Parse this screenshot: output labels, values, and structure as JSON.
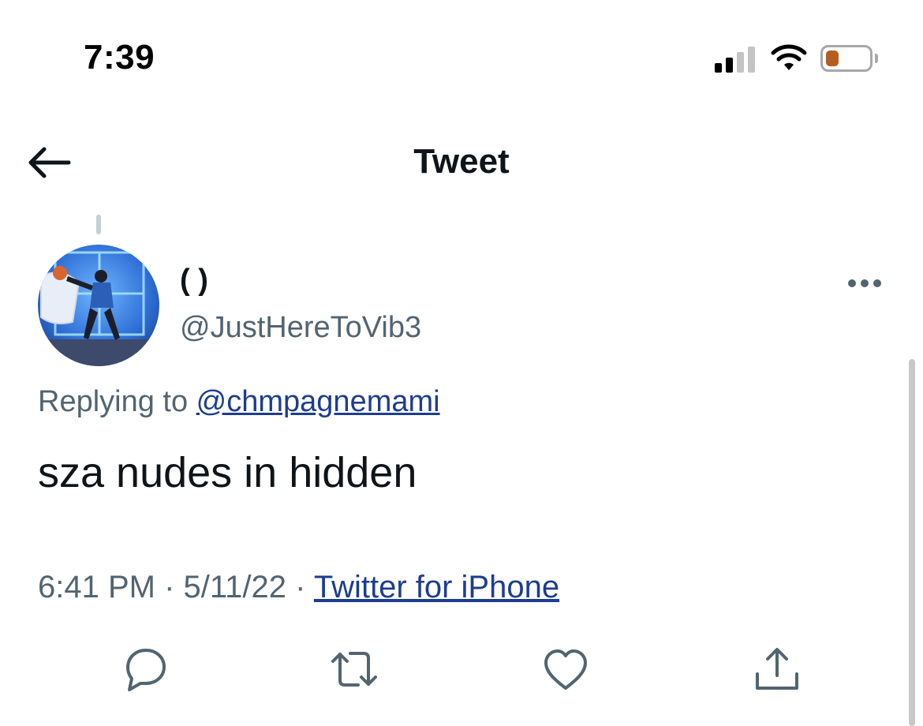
{
  "status_bar": {
    "time": "7:39",
    "battery_level": 0.3,
    "battery_color": "#b55e22",
    "signal_bars_active": 2,
    "signal_bars_total": 4
  },
  "header": {
    "title": "Tweet",
    "back_icon": "arrow-left-icon"
  },
  "tweet": {
    "display_name": "( )",
    "handle": "@JustHereToVib3",
    "replying_prefix": "Replying to ",
    "replying_to": "@chmpagnemami",
    "text": "sza nudes in hidden",
    "time": "6:41 PM",
    "separator": " · ",
    "date": "5/11/22",
    "source": "Twitter for iPhone"
  },
  "actions": [
    {
      "icon": "reply-icon"
    },
    {
      "icon": "retweet-icon"
    },
    {
      "icon": "like-icon"
    },
    {
      "icon": "share-icon"
    }
  ],
  "colors": {
    "text": "#0f1419",
    "secondary": "#536471",
    "link": "#1d3d8f",
    "icon": "#536471"
  }
}
